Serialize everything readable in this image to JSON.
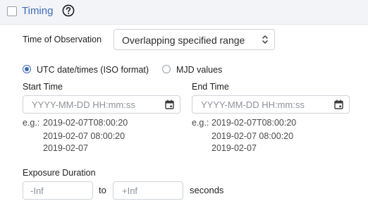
{
  "header": {
    "title": "Timing",
    "help_icon": "question-circle-icon"
  },
  "observation": {
    "label": "Time of Observation",
    "selected": "Overlapping specified range"
  },
  "format": {
    "options": [
      {
        "label": "UTC date/times (ISO format)",
        "selected": true
      },
      {
        "label": "MJD values",
        "selected": false
      }
    ]
  },
  "start": {
    "label": "Start Time",
    "placeholder": "YYYY-MM-DD HH:mm:ss",
    "eg_prefix": "e.g.:",
    "examples": [
      "2019-02-07T08:00:20",
      "2019-02-07 08:00:20",
      "2019-02-07"
    ]
  },
  "end": {
    "label": "End Time",
    "placeholder": "YYYY-MM-DD HH:mm:ss",
    "eg_prefix": "e.g.:",
    "examples": [
      "2019-02-07T08:00:20",
      "2019-02-07 08:00:20",
      "2019-02-07"
    ]
  },
  "exposure": {
    "label": "Exposure Duration",
    "min_placeholder": "-Inf",
    "to_label": "to",
    "max_placeholder": "+Inf",
    "unit": "seconds"
  },
  "colors": {
    "accent": "#3f6cb8",
    "header_bg": "#f3f4f7",
    "border": "#cfd3d9",
    "placeholder": "#8d9299"
  }
}
